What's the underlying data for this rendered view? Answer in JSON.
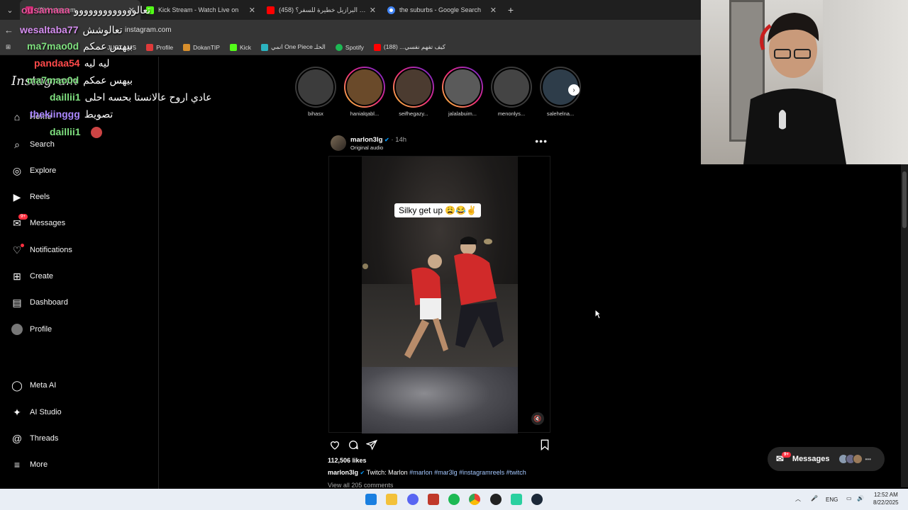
{
  "browser": {
    "tabs": [
      {
        "title": "(9) Instagram",
        "favicon_color": "#d62976",
        "active": true
      },
      {
        "title": "Kick Stream - Watch Live on",
        "favicon_color": "#53fc18",
        "active": false
      },
      {
        "title": "(458) هل البرازيل خطيرة للسفر؟",
        "favicon_color": "#ff0000",
        "active": false
      },
      {
        "title": "the suburbs - Google Search",
        "favicon_color": "#4285f4",
        "active": false
      }
    ],
    "url": "instagram.com",
    "bookmarks": [
      {
        "label": "JUST LMS",
        "color": "#666666"
      },
      {
        "label": "Profile",
        "color": "#e03a3a"
      },
      {
        "label": "DokanTIP",
        "color": "#d88f2c"
      },
      {
        "label": "Kick",
        "color": "#53fc18"
      },
      {
        "label": "انمي One Piece الحلـ",
        "color": "#2bb3c0"
      },
      {
        "label": "Spotify",
        "color": "#1db954"
      },
      {
        "label": "كيف تفهم نفسي... (188)",
        "color": "#ff0000"
      }
    ]
  },
  "chat": [
    {
      "user": "ousamaaa",
      "user_color": "#e8539c",
      "message": "تعالووووووووووووو"
    },
    {
      "user": "wesaltaba77",
      "user_color": "#d58ef0",
      "message": "تعالوشش"
    },
    {
      "user": "ma7mao0d",
      "user_color": "#7fe07f",
      "message": "بيهس عمكم"
    },
    {
      "user": "pandaa54",
      "user_color": "#ff4a4a",
      "message": "ليه ليه"
    },
    {
      "user": "ma7mao0d",
      "user_color": "#7fe07f",
      "message": "بيهس عمكم"
    },
    {
      "user": "daillii1",
      "user_color": "#7fe07f",
      "message": "عادي اروح عالانستا بحسه احلى"
    },
    {
      "user": "thekiinggg",
      "user_color": "#aa88ff",
      "message": "تصويط"
    },
    {
      "user": "daillii1",
      "user_color": "#7fe07f",
      "message": ""
    }
  ],
  "instagram": {
    "logo": "Instagram",
    "nav": [
      {
        "label": "Home",
        "icon": "home-icon"
      },
      {
        "label": "Search",
        "icon": "search-icon"
      },
      {
        "label": "Explore",
        "icon": "compass-icon"
      },
      {
        "label": "Reels",
        "icon": "reels-icon"
      },
      {
        "label": "Messages",
        "icon": "messenger-icon",
        "badge": "9+"
      },
      {
        "label": "Notifications",
        "icon": "heart-icon"
      },
      {
        "label": "Create",
        "icon": "plus-square-icon"
      },
      {
        "label": "Dashboard",
        "icon": "dashboard-icon"
      },
      {
        "label": "Profile",
        "icon": "avatar-icon"
      },
      {
        "label": "Meta AI",
        "icon": "meta-ai-icon"
      },
      {
        "label": "AI Studio",
        "icon": "ai-studio-icon"
      },
      {
        "label": "Threads",
        "icon": "threads-icon"
      },
      {
        "label": "More",
        "icon": "menu-icon"
      }
    ],
    "stories": [
      {
        "name": "bihasx",
        "seen": true
      },
      {
        "name": "hanialqabl...",
        "seen": false
      },
      {
        "name": "seifhegazy...",
        "seen": false
      },
      {
        "name": "jalalabuim...",
        "seen": false
      },
      {
        "name": "menonlys...",
        "seen": true
      },
      {
        "name": "salehelna...",
        "seen": true
      }
    ],
    "post": {
      "username": "marlon3lg",
      "time": "14h",
      "audio": "Original audio",
      "video_caption": "Silky get up 😩😂✌️",
      "likes": "112,506 likes",
      "caption_user": "marlon3lg",
      "caption_text": "Twitch: Marlon",
      "hashtags": "#marlon #mar3lg #instagramreels #twitch",
      "view_comments": "View all 205 comments"
    },
    "messages_pill": {
      "label": "Messages",
      "badge": "9+"
    }
  },
  "taskbar": {
    "language": "ENG",
    "time": "12:52 AM",
    "date": "8/22/2025"
  },
  "colors": {
    "accent": "#0095f6",
    "badge": "#ff3040",
    "background": "#000000"
  }
}
